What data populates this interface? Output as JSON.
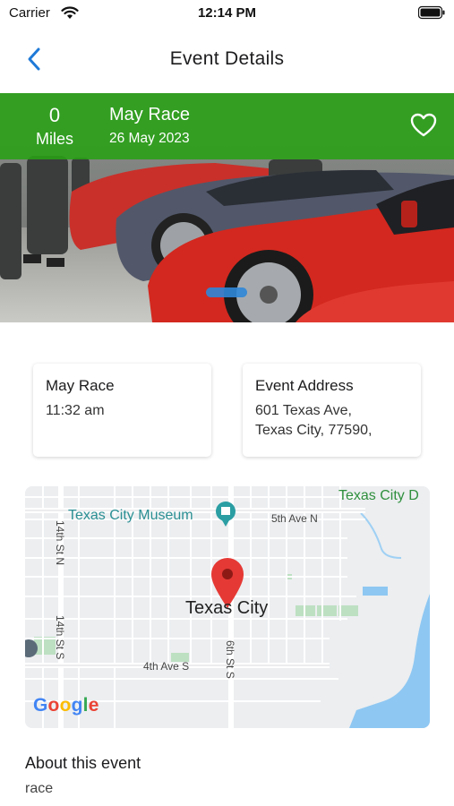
{
  "status_bar": {
    "carrier": "Carrier",
    "time": "12:14 PM"
  },
  "nav": {
    "title": "Event Details",
    "back_icon": "chevron-left-icon"
  },
  "hero": {
    "miles_value": "0",
    "miles_label": "Miles",
    "event_name": "May Race",
    "event_date": "26 May 2023",
    "favorite_icon": "heart-outline-icon",
    "banner_color": "#2ba01a",
    "image_subject": "row of parked sports cars"
  },
  "cards": {
    "time_card": {
      "title": "May Race",
      "time": "11:32 am"
    },
    "address_card": {
      "title": "Event Address",
      "line1": "601 Texas Ave,",
      "line2": "Texas City, 77590,"
    }
  },
  "map": {
    "city_label": "Texas City",
    "museum_label": "Texas City Museum",
    "city_d_label": "Texas City D",
    "street_5th": "5th Ave N",
    "street_4th": "4th Ave S",
    "street_14n": "14th St N",
    "street_14s": "14th St S",
    "street_6s": "6th St S",
    "google_g1": "G",
    "google_o1": "o",
    "google_o2": "o",
    "google_g2": "g",
    "google_l": "l",
    "google_e": "e",
    "pin_color": "#e53935",
    "water_color": "#8ec7f2"
  },
  "about": {
    "title": "About this event",
    "body": "race"
  },
  "colors": {
    "accent": "#1f7ad8",
    "text": "#1c1c1e"
  }
}
